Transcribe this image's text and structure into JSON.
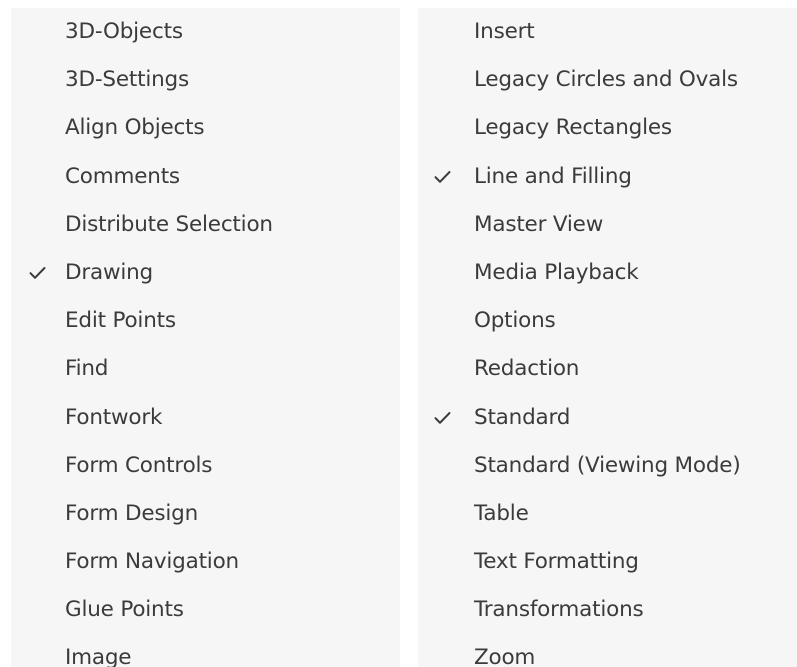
{
  "menus": {
    "left": {
      "items": [
        {
          "label": "3D-Objects",
          "checked": false
        },
        {
          "label": "3D-Settings",
          "checked": false
        },
        {
          "label": "Align Objects",
          "checked": false
        },
        {
          "label": "Comments",
          "checked": false
        },
        {
          "label": "Distribute Selection",
          "checked": false
        },
        {
          "label": "Drawing",
          "checked": true
        },
        {
          "label": "Edit Points",
          "checked": false
        },
        {
          "label": "Find",
          "checked": false
        },
        {
          "label": "Fontwork",
          "checked": false
        },
        {
          "label": "Form Controls",
          "checked": false
        },
        {
          "label": "Form Design",
          "checked": false
        },
        {
          "label": "Form Navigation",
          "checked": false
        },
        {
          "label": "Glue Points",
          "checked": false
        },
        {
          "label": "Image",
          "checked": false
        }
      ]
    },
    "right": {
      "items": [
        {
          "label": "Insert",
          "checked": false
        },
        {
          "label": "Legacy Circles and Ovals",
          "checked": false
        },
        {
          "label": "Legacy Rectangles",
          "checked": false
        },
        {
          "label": "Line and Filling",
          "checked": true
        },
        {
          "label": "Master View",
          "checked": false
        },
        {
          "label": "Media Playback",
          "checked": false
        },
        {
          "label": "Options",
          "checked": false
        },
        {
          "label": "Redaction",
          "checked": false
        },
        {
          "label": "Standard",
          "checked": true
        },
        {
          "label": "Standard (Viewing Mode)",
          "checked": false
        },
        {
          "label": "Table",
          "checked": false
        },
        {
          "label": "Text Formatting",
          "checked": false
        },
        {
          "label": "Transformations",
          "checked": false
        },
        {
          "label": "Zoom",
          "checked": false
        }
      ]
    }
  },
  "icons": {
    "check": "check-icon"
  },
  "colors": {
    "panel_background": "#f6f6f6",
    "text": "#3b3b3b",
    "check": "#3b3b3b"
  }
}
